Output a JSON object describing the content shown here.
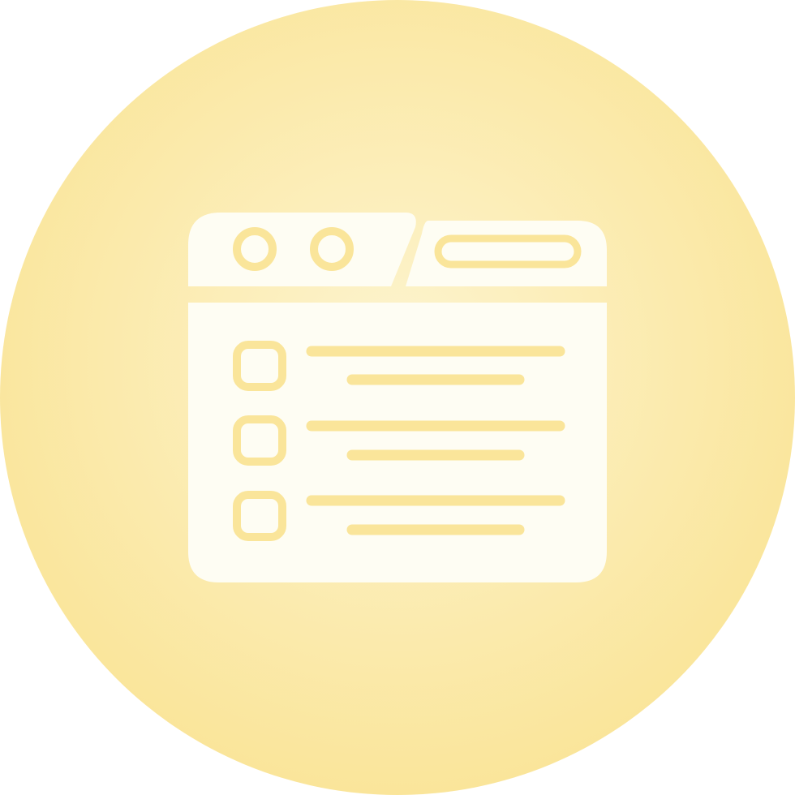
{
  "icon": {
    "name": "browser-checklist-icon",
    "colors": {
      "circle_center": "#FDF4CF",
      "circle_edge": "#FAE59A",
      "glyph_fill": "#FEFDF3",
      "glyph_stroke": "#FAE59A"
    },
    "list_rows": [
      {
        "checkbox": "checkbox-icon",
        "lines": 2
      },
      {
        "checkbox": "checkbox-icon",
        "lines": 2
      },
      {
        "checkbox": "checkbox-icon",
        "lines": 2
      }
    ]
  }
}
